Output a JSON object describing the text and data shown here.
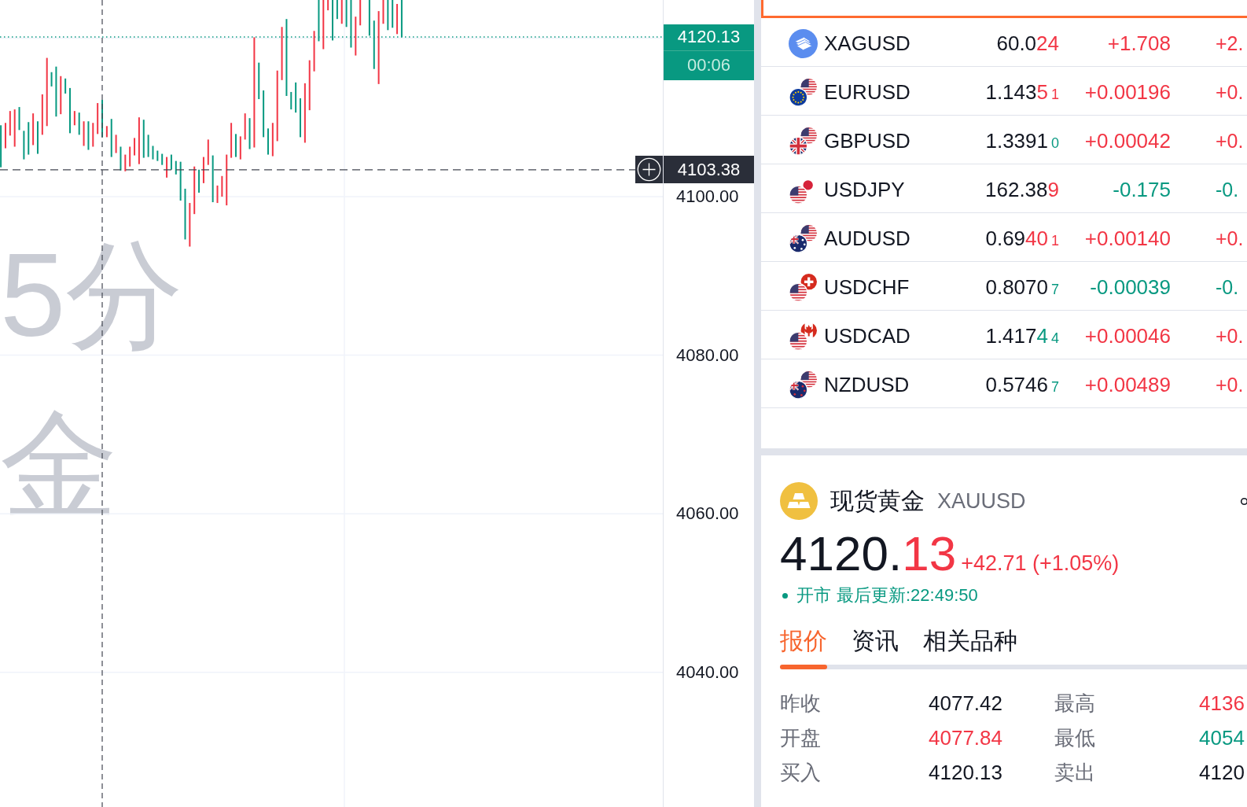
{
  "chart": {
    "watermark": [
      "5分",
      "金"
    ],
    "price_axis": [
      "4100.00",
      "4080.00",
      "4060.00",
      "4040.00"
    ],
    "last_price": {
      "price": "4120.13",
      "countdown": "00:06"
    },
    "crosshair": {
      "price": "4103.38"
    }
  },
  "watchlist": {
    "rows": [
      {
        "kind": "cut",
        "selected": true
      },
      {
        "kind": "quote",
        "selected": false,
        "symbol": "XAGUSD",
        "price_base": "60.0",
        "price_changed": "24",
        "price_up": true,
        "change": "+1.708",
        "change_up": true,
        "percent": "+2."
      },
      {
        "kind": "quote",
        "selected": false,
        "symbol": "EURUSD",
        "price_base": "1.143",
        "price_changed": "5",
        "price_pip": "1",
        "price_up": true,
        "change": "+0.00196",
        "change_up": true,
        "percent": "+0."
      },
      {
        "kind": "quote",
        "selected": false,
        "symbol": "GBPUSD",
        "price_base": "1.3391",
        "price_pip": "0",
        "price_up": false,
        "change": "+0.00042",
        "change_up": true,
        "percent": "+0."
      },
      {
        "kind": "quote",
        "selected": false,
        "symbol": "USDJPY",
        "price_base": "162.38",
        "price_changed": "9",
        "price_up": true,
        "change": "-0.175",
        "change_up": false,
        "percent": "-0."
      },
      {
        "kind": "quote",
        "selected": false,
        "symbol": "AUDUSD",
        "price_base": "0.69",
        "price_changed": "40",
        "price_pip": "1",
        "price_up": true,
        "change": "+0.00140",
        "change_up": true,
        "percent": "+0."
      },
      {
        "kind": "quote",
        "selected": false,
        "symbol": "USDCHF",
        "price_base": "0.8070",
        "price_pip": "7",
        "price_up": false,
        "change": "-0.00039",
        "change_up": false,
        "percent": "-0."
      },
      {
        "kind": "quote",
        "selected": false,
        "symbol": "USDCAD",
        "price_base": "1.417",
        "price_changed": "4",
        "price_pip": "4",
        "price_up": false,
        "change": "+0.00046",
        "change_up": true,
        "percent": "+0."
      },
      {
        "kind": "quote",
        "selected": false,
        "symbol": "NZDUSD",
        "price_base": "0.5746",
        "price_pip": "7",
        "price_up": false,
        "change": "+0.00489",
        "change_up": true,
        "percent": "+0."
      }
    ]
  },
  "detail": {
    "name": "现货黄金",
    "symbol": "XAUUSD",
    "price_base": "4120.",
    "price_changed": "13",
    "price_up": true,
    "change": "+42.71 (+1.05%)",
    "change_up": true,
    "market": {
      "label": "开市",
      "open": true
    },
    "last_update": "最后更新:22:49:50",
    "tabs": [
      {
        "label": "报价",
        "selected": true
      },
      {
        "label": "资讯",
        "selected": false
      },
      {
        "label": "相关品种",
        "selected": false
      }
    ],
    "stats": [
      {
        "label": "昨收",
        "value": "4077.42",
        "color": "#131722"
      },
      {
        "label": "最高",
        "value": "4136",
        "color": "#f23645"
      },
      {
        "label": "开盘",
        "value": "4077.84",
        "color": "#f23645"
      },
      {
        "label": "最低",
        "value": "4054",
        "color": "#089981"
      },
      {
        "label": "买入",
        "value": "4120.13",
        "color": "#131722"
      },
      {
        "label": "卖出",
        "value": "4120",
        "color": "#131722"
      }
    ]
  }
}
